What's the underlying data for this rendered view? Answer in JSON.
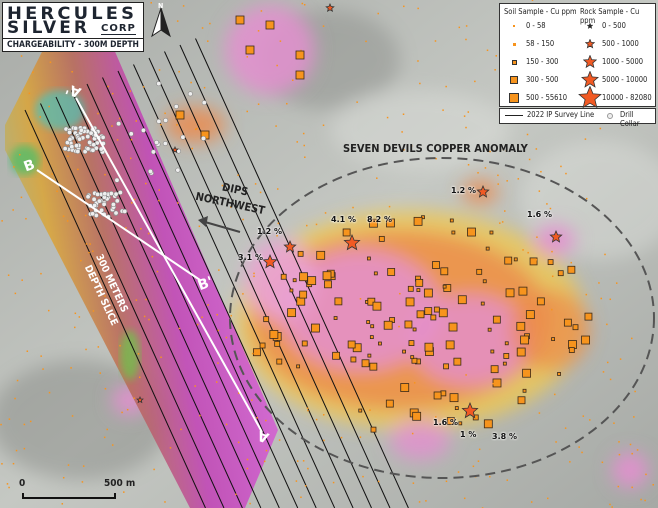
{
  "header": {
    "logo_line1": "HERCULES",
    "logo_line2": "SILVER",
    "logo_corp": "CORP",
    "subtitle": "CHARGEABILITY - 300M DEPTH",
    "north_label": "N"
  },
  "legend": {
    "soil_title": "Soil Sample - Cu ppm",
    "rock_title": "Rock Sample - Cu ppm",
    "soil_classes": [
      "0 - 58",
      "58 - 150",
      "150 - 300",
      "300 - 500",
      "500 - 55610"
    ],
    "rock_classes": [
      "0 - 500",
      "500 - 1000",
      "1000 - 5000",
      "5000 - 10000",
      "10000 - 82080"
    ],
    "survey_line_label": "2022 IP Survey Line",
    "drill_collar_label": "Drill Collar"
  },
  "map": {
    "anomaly_label": "SEVEN DEVILS COPPER ANOMALY",
    "dips_line1": "DIPS",
    "dips_line2": "NORTHWEST",
    "slice_line1": "300 METERS",
    "slice_line2": "DEPTH SLICE",
    "sections": {
      "a": "A",
      "a_prime": "A'",
      "b": "B",
      "b_prime": "B'"
    },
    "assay_labels": [
      "1.2 %",
      "4.1 %",
      "8.2 %",
      "1.2 %",
      "3.1 %",
      "1.6 %",
      "1.6 %",
      "1 %",
      "3.8 %"
    ],
    "scale_start": "0",
    "scale_end": "500 m"
  },
  "colors": {
    "soil": "#f7941d",
    "star": "#f15a24",
    "high_charge": "#d23ad0",
    "low_charge": "#36c060"
  }
}
